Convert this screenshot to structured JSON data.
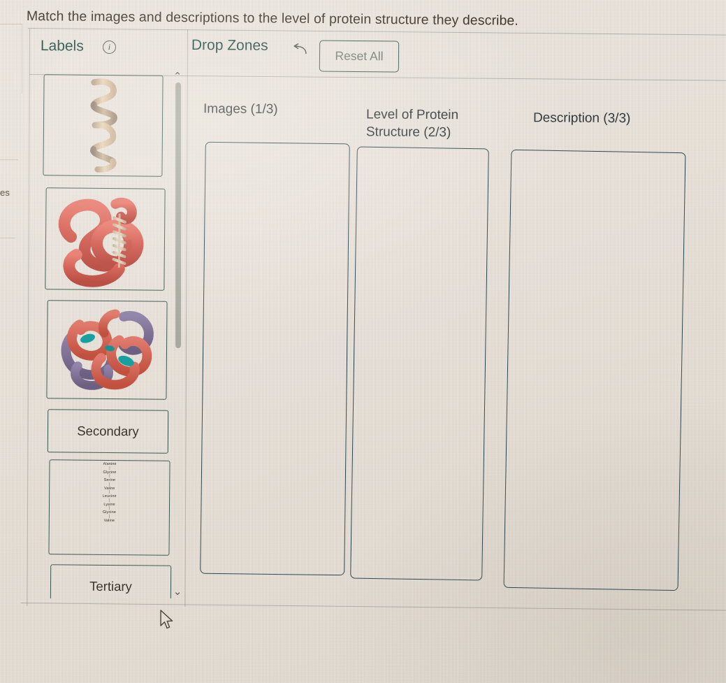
{
  "page": {
    "title": "Match the images and descriptions to the level of protein structure they describe.",
    "background_clipped_text": "es"
  },
  "toolbar": {
    "labels_heading": "Labels",
    "info_icon": "info-circle-icon",
    "info_glyph": "i",
    "dropzones_heading": "Drop Zones",
    "undo_icon": "undo-arrow-icon",
    "reset_label": "Reset All"
  },
  "labels_panel": {
    "scroll_up_glyph": "⌃",
    "scroll_down_glyph": "⌄",
    "cards": [
      {
        "id": "card-alpha-helix",
        "type": "image",
        "name": "alpha-helix-ribbon-image",
        "text": ""
      },
      {
        "id": "card-tertiary-fold",
        "type": "image",
        "name": "tertiary-folded-protein-image",
        "text": ""
      },
      {
        "id": "card-quaternary-hemoglobin",
        "type": "image",
        "name": "quaternary-hemoglobin-image",
        "text": ""
      },
      {
        "id": "card-secondary",
        "type": "text",
        "name": "label-card-secondary",
        "text": "Secondary"
      },
      {
        "id": "card-amino-sequence",
        "type": "sequence",
        "name": "amino-acid-sequence-image",
        "text": "",
        "sequence": [
          "Alanine",
          "Glycine",
          "Serine",
          "Valine",
          "Leucine",
          "Lysine",
          "Glycine",
          "Valine"
        ],
        "linker": "|"
      },
      {
        "id": "card-tertiary",
        "type": "text",
        "name": "label-card-tertiary",
        "text": "Tertiary"
      }
    ]
  },
  "dropzone_columns": [
    {
      "id": "col-images",
      "heading": "Images (1/3)",
      "content": ""
    },
    {
      "id": "col-level",
      "heading": "Level of Protein Structure (2/3)",
      "content": ""
    },
    {
      "id": "col-description",
      "heading": "Description (3/3)",
      "content": ""
    }
  ],
  "colors": {
    "background": "#e8e0d4",
    "accent_teal": "#1f4d45",
    "border_dark": "#2f4a52",
    "text_body": "#3b332a",
    "muted_text": "#6f7c75"
  }
}
